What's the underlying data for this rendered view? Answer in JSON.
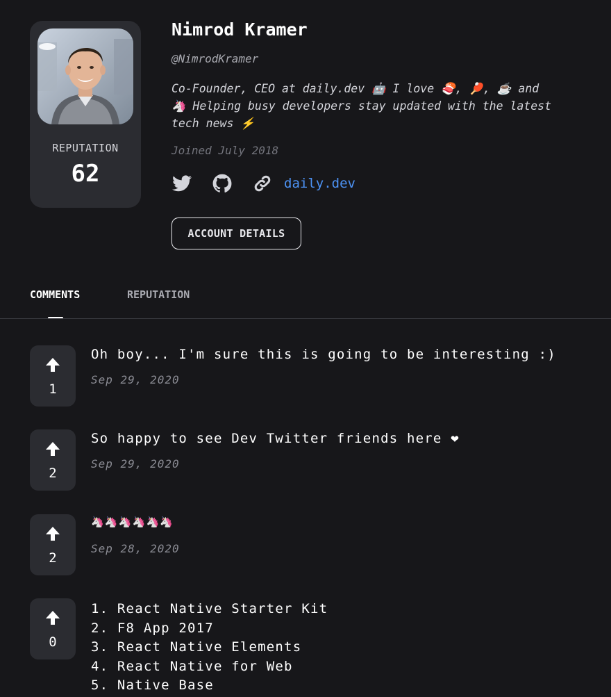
{
  "profile": {
    "name": "Nimrod Kramer",
    "handle": "@NimrodKramer",
    "bio_lines": [
      "Co-Founder, CEO at daily.dev 🤖 I love 🍣, 🏓, ☕ and",
      "🦄 Helping busy developers stay updated with the latest",
      "tech news ⚡"
    ],
    "joined": "Joined July 2018",
    "reputation_label": "REPUTATION",
    "reputation_value": "62",
    "website_label": "daily.dev",
    "account_button": "ACCOUNT DETAILS"
  },
  "icons": {
    "twitter": "twitter-icon",
    "github": "github-icon",
    "link": "link-icon",
    "upvote": "upvote-arrow-icon"
  },
  "tabs": [
    {
      "label": "COMMENTS",
      "active": true
    },
    {
      "label": "REPUTATION",
      "active": false
    }
  ],
  "comments": [
    {
      "upvotes": "1",
      "text": "Oh boy... I'm sure this is going to be interesting :)",
      "date": "Sep 29, 2020"
    },
    {
      "upvotes": "2",
      "text": "So happy to see Dev Twitter friends here ❤",
      "date": "Sep 29, 2020"
    },
    {
      "upvotes": "2",
      "text": "🦄🦄🦄🦄🦄🦄",
      "date": "Sep 28, 2020"
    },
    {
      "upvotes": "0",
      "list": [
        "1. React Native Starter Kit",
        "2. F8 App 2017",
        "3. React Native Elements",
        "4. React Native for Web",
        "5. Native Base"
      ]
    }
  ],
  "colors": {
    "background": "#17171a",
    "card": "#2b2c31",
    "link": "#4d93f5",
    "muted": "#8a8b93"
  }
}
